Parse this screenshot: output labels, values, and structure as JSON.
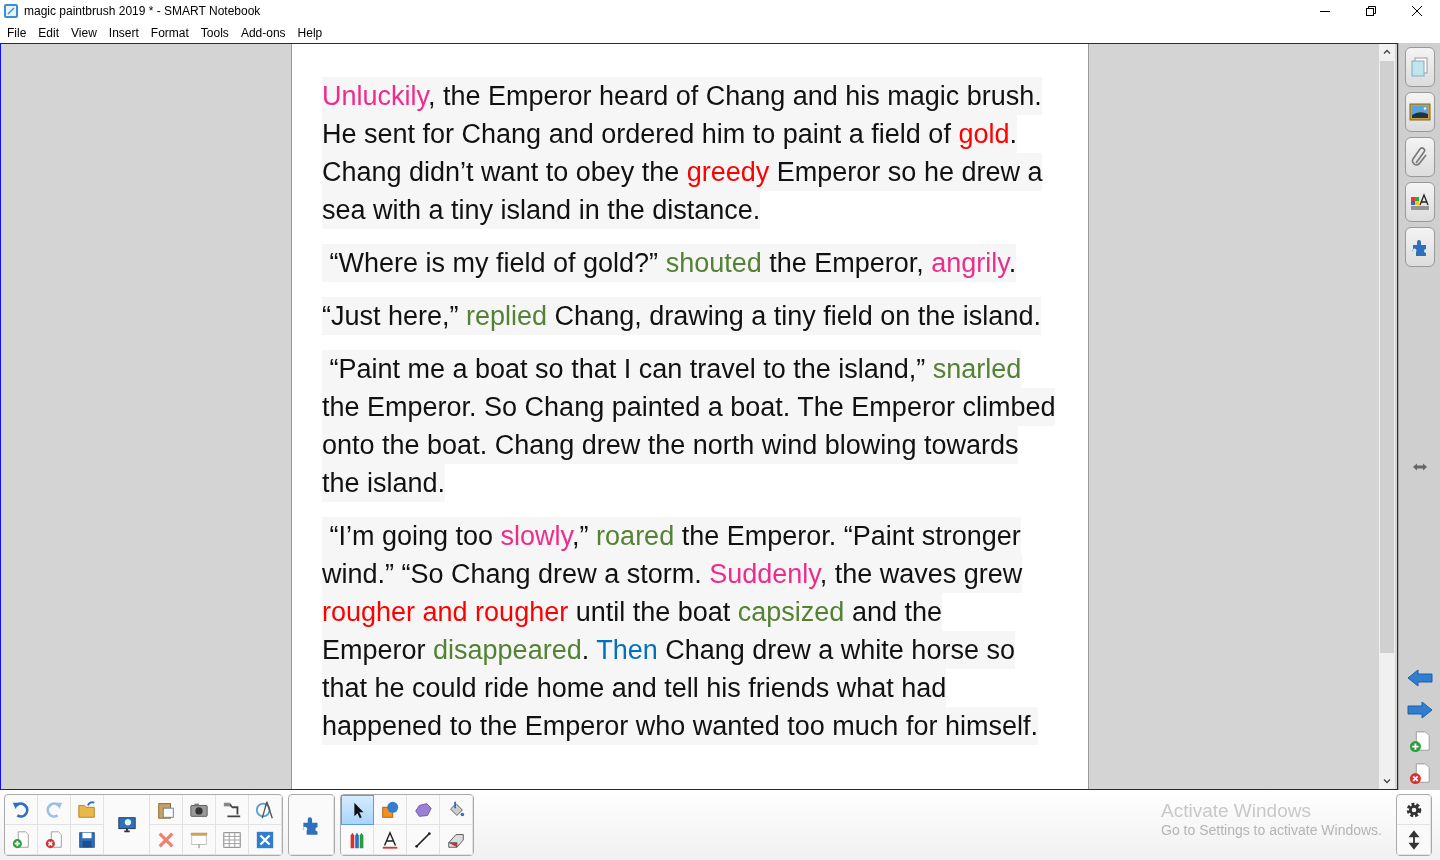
{
  "window": {
    "title": "magic paintbrush 2019 * - SMART Notebook"
  },
  "menu": [
    "File",
    "Edit",
    "View",
    "Insert",
    "Format",
    "Tools",
    "Add-ons",
    "Help"
  ],
  "page": {
    "paragraphs": [
      {
        "lines": [
          [
            {
              "text": "Unluckily",
              "color": "#ec2d8c"
            },
            {
              "text": ", the Emperor heard of Chang and his magic brush."
            }
          ],
          [
            {
              "text": "He sent for Chang and ordered him to paint a field of "
            },
            {
              "text": "gold",
              "color": "#ff0000"
            },
            {
              "text": "."
            }
          ],
          [
            {
              "text": "Chang didn’t want to obey the "
            },
            {
              "text": "greedy",
              "color": "#ff0000"
            },
            {
              "text": " Emperor so he drew a"
            }
          ],
          [
            {
              "text": "sea with a tiny island in the distance."
            }
          ]
        ]
      },
      {
        "lines": [
          [
            {
              "text": " “Where is my field of gold?” "
            },
            {
              "text": "shouted",
              "color": "#548235"
            },
            {
              "text": " the Emperor, "
            },
            {
              "text": "angrily",
              "color": "#ec2d8c"
            },
            {
              "text": "."
            }
          ]
        ]
      },
      {
        "lines": [
          [
            {
              "text": "“Just here,” "
            },
            {
              "text": "replied",
              "color": "#548235"
            },
            {
              "text": " Chang, drawing a tiny field on the island."
            }
          ]
        ]
      },
      {
        "lines": [
          [
            {
              "text": " “Paint me a boat so that I can travel to the island,” "
            },
            {
              "text": "snarled",
              "color": "#548235"
            }
          ],
          [
            {
              "text": "the Emperor. So Chang painted a boat. The Emperor climbed"
            }
          ],
          [
            {
              "text": "onto the boat. Chang drew the north wind blowing towards"
            }
          ],
          [
            {
              "text": "the island."
            }
          ]
        ]
      },
      {
        "lines": [
          [
            {
              "text": " “I’m going too "
            },
            {
              "text": "slowly",
              "color": "#ec2d8c"
            },
            {
              "text": ",” "
            },
            {
              "text": "roared",
              "color": "#548235"
            },
            {
              "text": " the Emperor. “Paint stronger"
            }
          ],
          [
            {
              "text": "wind.” “So Chang drew a storm. "
            },
            {
              "text": "Suddenly",
              "color": "#ec2d8c"
            },
            {
              "text": ", the waves grew"
            }
          ],
          [
            {
              "text": "rougher and rougher",
              "color": "#ff0000"
            },
            {
              "text": " until the boat "
            },
            {
              "text": "capsized",
              "color": "#548235"
            },
            {
              "text": " and the"
            }
          ],
          [
            {
              "text": "Emperor "
            },
            {
              "text": "disappeared",
              "color": "#548235"
            },
            {
              "text": ". "
            },
            {
              "text": "Then",
              "color": "#0070c0"
            },
            {
              "text": " Chang drew a white horse so"
            }
          ],
          [
            {
              "text": "that he could ride home and tell his friends what had"
            }
          ],
          [
            {
              "text": "happened to the Emperor who wanted too much for himself."
            }
          ]
        ]
      }
    ]
  },
  "toolbar": {
    "tools": [
      {
        "kind": "select",
        "selected": true
      },
      {
        "kind": "shapes",
        "selected": false
      },
      {
        "kind": "polygons",
        "selected": false
      },
      {
        "kind": "fill",
        "selected": false
      },
      {
        "kind": "pens",
        "selected": false
      },
      {
        "kind": "text",
        "selected": false
      },
      {
        "kind": "line",
        "selected": false
      },
      {
        "kind": "eraser",
        "selected": false
      }
    ]
  },
  "notice": {
    "title": "Activate Windows",
    "text": "Go to Settings to activate Windows."
  }
}
